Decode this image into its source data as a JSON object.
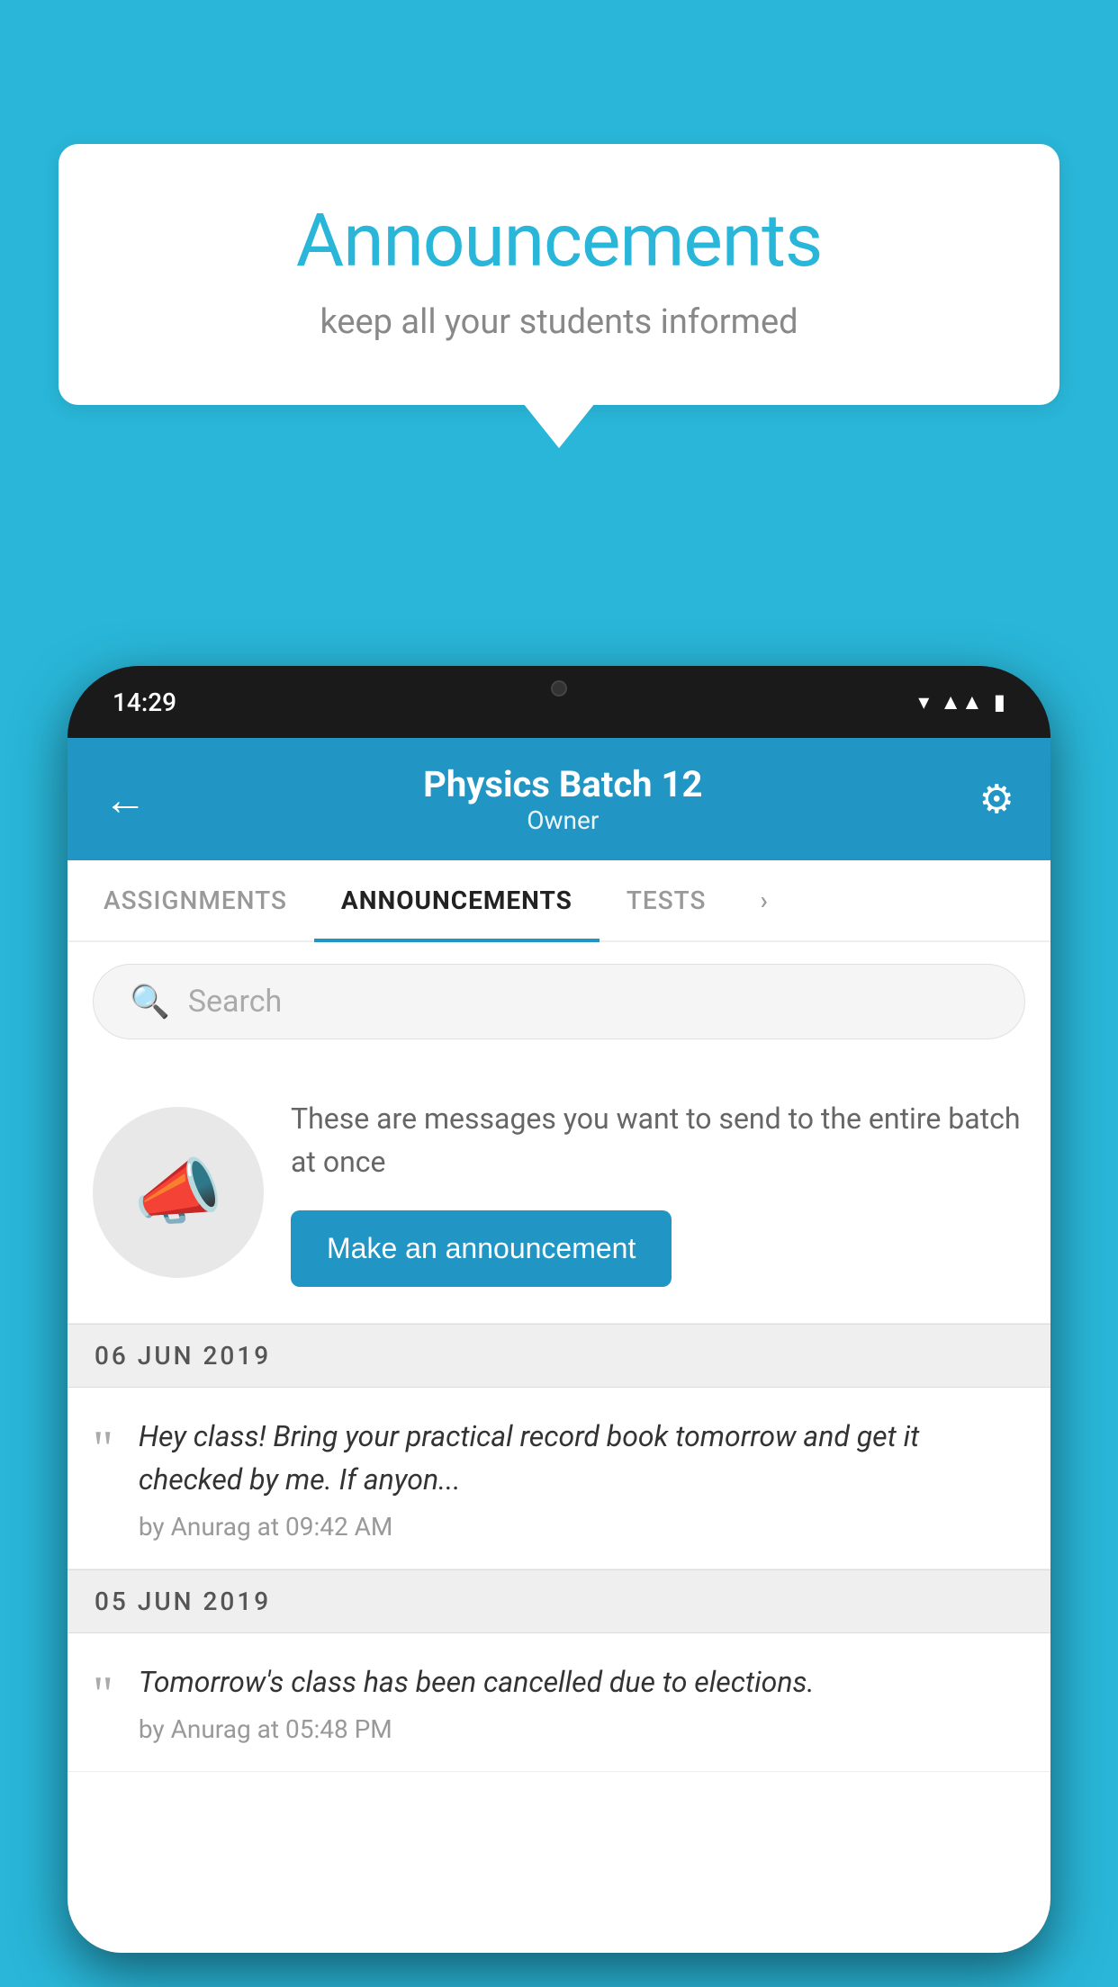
{
  "background_color": "#29b6d8",
  "speech_bubble": {
    "title": "Announcements",
    "subtitle": "keep all your students informed"
  },
  "phone": {
    "status_bar": {
      "time": "14:29",
      "icons": [
        "wifi",
        "signal",
        "battery"
      ]
    },
    "header": {
      "title": "Physics Batch 12",
      "subtitle": "Owner",
      "back_label": "←",
      "gear_label": "⚙"
    },
    "tabs": [
      {
        "label": "ASSIGNMENTS",
        "active": false
      },
      {
        "label": "ANNOUNCEMENTS",
        "active": true
      },
      {
        "label": "TESTS",
        "active": false
      },
      {
        "label": "...",
        "active": false
      }
    ],
    "search": {
      "placeholder": "Search"
    },
    "intro_section": {
      "description": "These are messages you want to send to the entire batch at once",
      "button_label": "Make an announcement"
    },
    "announcements": [
      {
        "date": "06  JUN  2019",
        "text": "Hey class! Bring your practical record book tomorrow and get it checked by me. If anyon...",
        "meta": "by Anurag at 09:42 AM"
      },
      {
        "date": "05  JUN  2019",
        "text": "Tomorrow's class has been cancelled due to elections.",
        "meta": "by Anurag at 05:48 PM"
      }
    ]
  }
}
